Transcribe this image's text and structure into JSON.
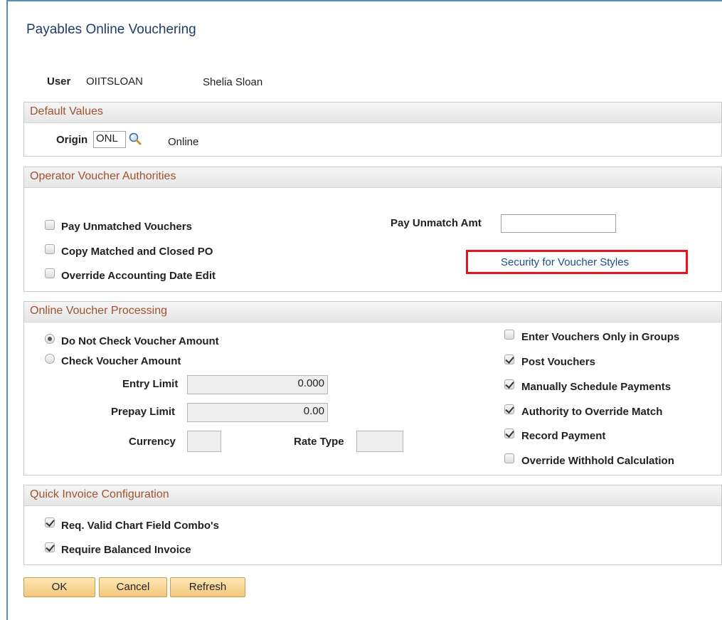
{
  "dialog": {
    "title": "Payables Online Vouchering"
  },
  "user": {
    "label": "User",
    "id": "OIITSLOAN",
    "name": "Shelia Sloan"
  },
  "default_values": {
    "title": "Default Values",
    "origin_label": "Origin",
    "origin_value": "ONL",
    "origin_description": "Online"
  },
  "operator_authorities": {
    "title": "Operator Voucher Authorities",
    "checkboxes": [
      {
        "label": "Pay Unmatched Vouchers",
        "checked": false
      },
      {
        "label": "Copy Matched and Closed PO",
        "checked": false
      },
      {
        "label": "Override Accounting Date Edit",
        "checked": false
      }
    ],
    "pay_unmatch_amt_label": "Pay Unmatch Amt",
    "pay_unmatch_amt_value": "",
    "security_link": "Security for Voucher Styles"
  },
  "online_processing": {
    "title": "Online Voucher Processing",
    "radios": [
      {
        "label": "Do Not Check Voucher Amount",
        "selected": true
      },
      {
        "label": "Check Voucher Amount",
        "selected": false
      }
    ],
    "entry_limit_label": "Entry Limit",
    "entry_limit_value": "0.000",
    "prepay_limit_label": "Prepay Limit",
    "prepay_limit_value": "0.00",
    "currency_label": "Currency",
    "currency_value": "",
    "rate_type_label": "Rate Type",
    "rate_type_value": "",
    "checkboxes": [
      {
        "label": "Enter Vouchers Only in Groups",
        "checked": false
      },
      {
        "label": "Post Vouchers",
        "checked": true
      },
      {
        "label": "Manually Schedule Payments",
        "checked": true
      },
      {
        "label": "Authority to Override Match",
        "checked": true
      },
      {
        "label": "Record Payment",
        "checked": true
      },
      {
        "label": "Override Withhold Calculation",
        "checked": false
      }
    ]
  },
  "quick_invoice": {
    "title": "Quick Invoice Configuration",
    "checkboxes": [
      {
        "label": "Req. Valid Chart Field Combo's",
        "checked": true
      },
      {
        "label": "Require Balanced Invoice",
        "checked": true
      }
    ]
  },
  "buttons": {
    "ok": "OK",
    "cancel": "Cancel",
    "refresh": "Refresh"
  },
  "colors": {
    "section_title": "#a0522d",
    "link": "#1b4f8a",
    "highlight": "#e8141b",
    "button": "#f4c77c"
  },
  "icons": {
    "lookup": "magnifier-icon"
  }
}
